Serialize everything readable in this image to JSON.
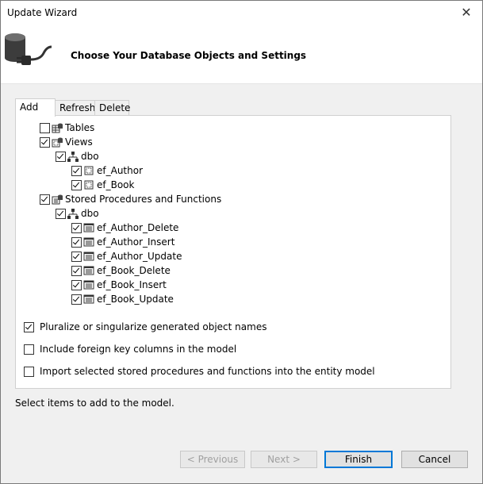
{
  "window": {
    "title": "Update Wizard",
    "close_symbol": "✕"
  },
  "header": {
    "title": "Choose Your Database Objects and Settings"
  },
  "tabs": [
    {
      "label": "Add",
      "active": true
    },
    {
      "label": "Refresh",
      "active": false
    },
    {
      "label": "Delete",
      "active": false
    }
  ],
  "tree": {
    "tables": {
      "label": "Tables",
      "checked": false
    },
    "views": {
      "label": "Views",
      "checked": true,
      "schema": {
        "label": "dbo",
        "checked": true
      },
      "items": [
        {
          "label": "ef_Author",
          "checked": true
        },
        {
          "label": "ef_Book",
          "checked": true
        }
      ]
    },
    "procs": {
      "label": "Stored Procedures and Functions",
      "checked": true,
      "schema": {
        "label": "dbo",
        "checked": true
      },
      "items": [
        {
          "label": "ef_Author_Delete",
          "checked": true
        },
        {
          "label": "ef_Author_Insert",
          "checked": true
        },
        {
          "label": "ef_Author_Update",
          "checked": true
        },
        {
          "label": "ef_Book_Delete",
          "checked": true
        },
        {
          "label": "ef_Book_Insert",
          "checked": true
        },
        {
          "label": "ef_Book_Update",
          "checked": true
        }
      ]
    }
  },
  "options": [
    {
      "label": "Pluralize or singularize generated object names",
      "checked": true
    },
    {
      "label": "Include foreign key columns in the model",
      "checked": false
    },
    {
      "label": "Import selected stored procedures and functions into the entity model",
      "checked": false
    }
  ],
  "status": "Select items to add to the model.",
  "buttons": {
    "previous": "< Previous",
    "next": "Next >",
    "finish": "Finish",
    "cancel": "Cancel"
  },
  "icons": {
    "window": "database-connection-icon",
    "tables": "tables-folder-icon",
    "views": "views-folder-icon",
    "procs": "procedures-folder-icon",
    "schema": "schema-icon",
    "view_item": "view-icon",
    "proc_item": "stored-procedure-icon"
  }
}
